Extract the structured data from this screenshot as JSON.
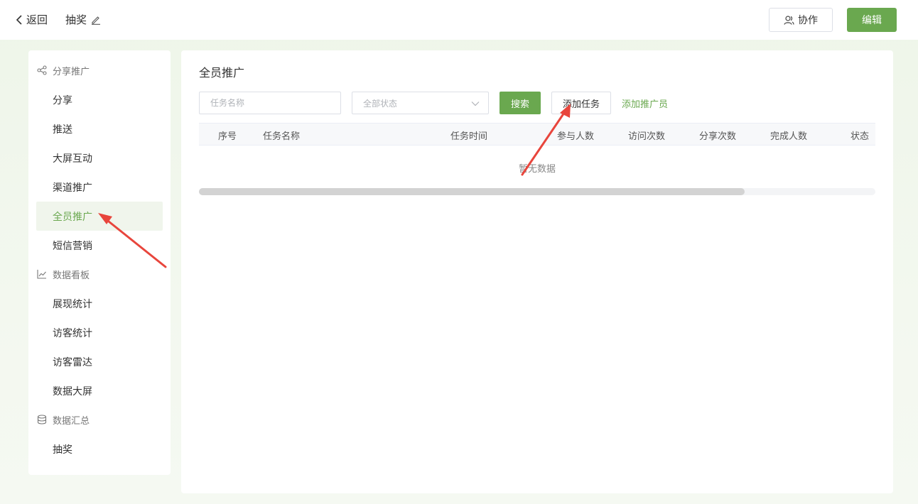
{
  "header": {
    "back_label": "返回",
    "title": "抽奖",
    "collab_label": "协作",
    "edit_label": "编辑"
  },
  "sidebar": {
    "groups": [
      {
        "title": "分享推广",
        "icon": "share-icon",
        "items": [
          "分享",
          "推送",
          "大屏互动",
          "渠道推广",
          "全员推广",
          "短信营销"
        ]
      },
      {
        "title": "数据看板",
        "icon": "chart-line-icon",
        "items": [
          "展现统计",
          "访客统计",
          "访客雷达",
          "数据大屏"
        ]
      },
      {
        "title": "数据汇总",
        "icon": "database-icon",
        "items": [
          "抽奖"
        ]
      }
    ],
    "active_item": "全员推广"
  },
  "main": {
    "title": "全员推广",
    "task_name_placeholder": "任务名称",
    "status_select_value": "全部状态",
    "search_label": "搜索",
    "add_task_label": "添加任务",
    "add_promoter_label": "添加推广员",
    "table": {
      "columns": [
        "序号",
        "任务名称",
        "任务时间",
        "参与人数",
        "访问次数",
        "分享次数",
        "完成人数",
        "状态"
      ],
      "empty_text": "暂无数据"
    }
  },
  "colors": {
    "accent": "#6aa84f",
    "annotation_arrow": "#e8453c"
  }
}
